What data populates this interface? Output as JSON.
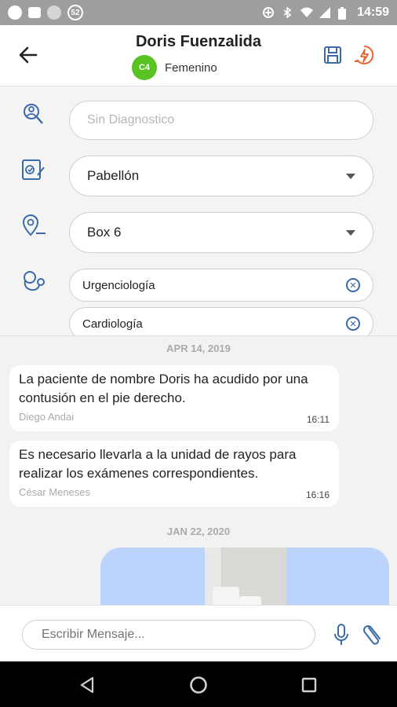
{
  "status_bar": {
    "notif_count": "52",
    "time": "14:59"
  },
  "header": {
    "patient_name": "Doris Fuenzalida",
    "category_badge": "C4",
    "gender": "Femenino",
    "colors": {
      "badge": "#58c322",
      "accent_blue": "#3b6aa8",
      "alert_orange": "#e8642d"
    }
  },
  "form": {
    "diagnosis": {
      "placeholder": "Sin Diagnostico",
      "value": ""
    },
    "ward": {
      "selected": "Pabellón"
    },
    "box": {
      "selected": "Box 6"
    },
    "specialties": [
      "Urgenciología",
      "Cardiología"
    ]
  },
  "chat": {
    "groups": [
      {
        "date": "APR 14, 2019",
        "messages": [
          {
            "text": "La paciente de nombre Doris ha acudido por una contusión en el pie derecho.",
            "author": "Diego Andai",
            "time": "16:11"
          },
          {
            "text": "Es necesario llevarla a la unidad de rayos para realizar los exámenes correspondientes.",
            "author": "César Meneses",
            "time": "16:16"
          }
        ]
      },
      {
        "date": "JAN 22, 2020",
        "messages": []
      }
    ]
  },
  "composer": {
    "placeholder": "Escribir Mensaje..."
  },
  "icons": {
    "diagnosis": "search-person-icon",
    "ward": "clipboard-edit-icon",
    "box": "location-pin-icon",
    "specialty": "stethoscope-icon",
    "save": "save-icon",
    "alert": "alert-bolt-icon"
  }
}
